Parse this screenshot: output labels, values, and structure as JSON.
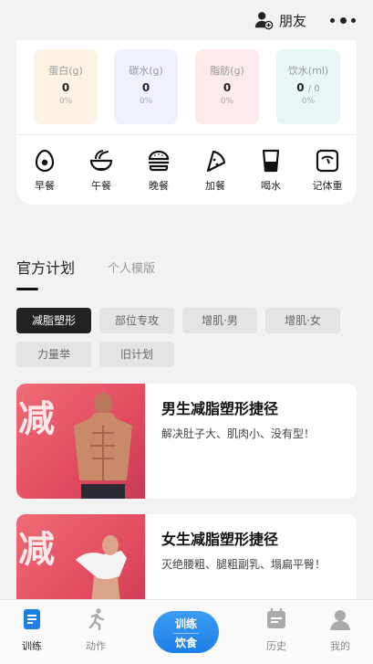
{
  "header": {
    "friends_label": "朋友"
  },
  "nutrition": [
    {
      "label": "蛋白(g)",
      "value": "0",
      "total": "",
      "percent": "0%"
    },
    {
      "label": "碳水(g)",
      "value": "0",
      "total": "",
      "percent": "0%"
    },
    {
      "label": "脂肪(g)",
      "value": "0",
      "total": "",
      "percent": "0%"
    },
    {
      "label": "饮水(ml)",
      "value": "0",
      "total": "/ 0",
      "percent": "0%"
    }
  ],
  "meals": [
    {
      "label": "早餐",
      "icon": "egg-icon"
    },
    {
      "label": "午餐",
      "icon": "noodle-bowl-icon"
    },
    {
      "label": "晚餐",
      "icon": "burger-icon"
    },
    {
      "label": "加餐",
      "icon": "pizza-icon"
    },
    {
      "label": "喝水",
      "icon": "cup-icon"
    },
    {
      "label": "记体重",
      "icon": "scale-icon"
    }
  ],
  "plans": {
    "tab_official": "官方计划",
    "tab_personal": "个人模版",
    "categories": [
      "减脂塑形",
      "部位专攻",
      "增肌·男",
      "增肌·女",
      "力量举",
      "旧计划"
    ],
    "active_category": "减脂塑形",
    "image_glyph": "减",
    "items": [
      {
        "title": "男生减脂塑形捷径",
        "desc": "解决肚子大、肌肉小、没有型！"
      },
      {
        "title": "女生减脂塑形捷径",
        "desc": "灭绝腰粗、腿粗副乳、塌扁平臀！"
      }
    ]
  },
  "bottom_nav": {
    "train": "训练",
    "action": "动作",
    "center_line1": "训练",
    "center_line2": "饮食",
    "history": "历史",
    "mine": "我的"
  },
  "colors": {
    "accent": "#1d7fe6",
    "plan_image": "#e24a60",
    "chip_active": "#222222"
  }
}
